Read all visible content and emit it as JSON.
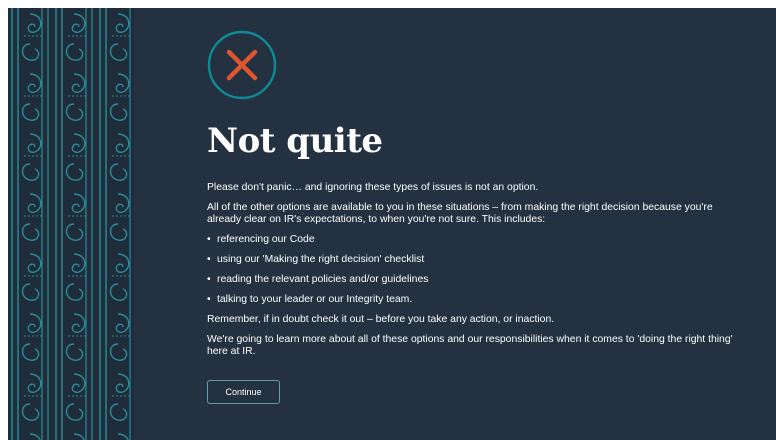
{
  "colors": {
    "background": "#233141",
    "accent_teal": "#0f8b96",
    "pattern_teal": "#2a8c97",
    "error_orange": "#e0552e",
    "text": "#ffffff"
  },
  "feedback": {
    "icon": "x-mark-icon",
    "title": "Not quite",
    "paragraph_1": "Please don't panic… and ignoring these types of issues is not an option.",
    "paragraph_2": "All of the other options are available to you in these situations – from making the right decision because you're already clear on IR's expectations, to when you're not sure. This includes:",
    "bullets": [
      "referencing our Code",
      "using our 'Making the right decision' checklist",
      "reading the relevant policies and/or guidelines",
      "talking to your leader or our Integrity team."
    ],
    "paragraph_3": "Remember, if in doubt check it out – before you take any action, or inaction.",
    "paragraph_4": "We're going to learn more about all of these options and our responsibilities when it comes to 'doing the right thing' here at IR.",
    "continue_label": "Continue"
  }
}
